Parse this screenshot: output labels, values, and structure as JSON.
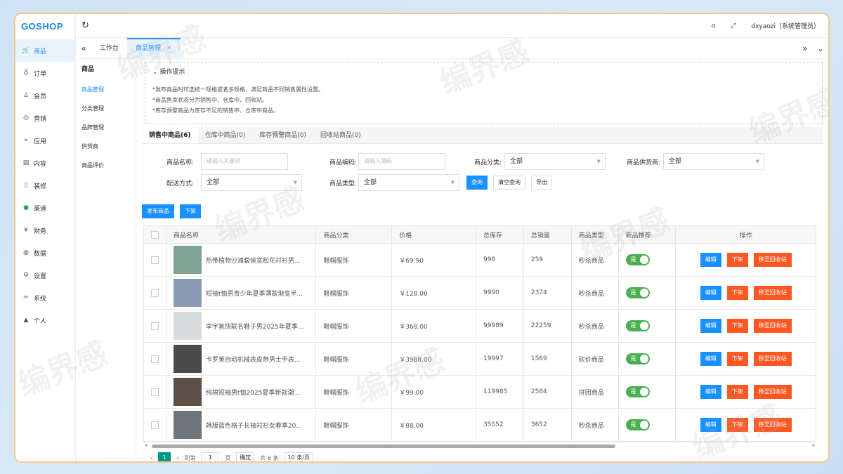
{
  "app": {
    "logo": "GOSHOP",
    "user": "dxyaozi（系统管理员）"
  },
  "sidebar": {
    "items": [
      {
        "label": "商品",
        "icon": "cart-icon",
        "glyph": "🛒",
        "active": true
      },
      {
        "label": "订单",
        "icon": "bell-icon",
        "glyph": "♁"
      },
      {
        "label": "会员",
        "icon": "user-icon",
        "glyph": "♙"
      },
      {
        "label": "营销",
        "icon": "gift-icon",
        "glyph": "◎"
      },
      {
        "label": "应用",
        "icon": "send-icon",
        "glyph": "➢"
      },
      {
        "label": "内容",
        "icon": "book-icon",
        "glyph": "▤"
      },
      {
        "label": "装修",
        "icon": "phone-icon",
        "glyph": "▯"
      },
      {
        "label": "渠道",
        "icon": "wechat-icon",
        "glyph": "●"
      },
      {
        "label": "财务",
        "icon": "money-icon",
        "glyph": "¥"
      },
      {
        "label": "数据",
        "icon": "globe-icon",
        "glyph": "◍"
      },
      {
        "label": "设置",
        "icon": "settings-icon",
        "glyph": "⚙"
      },
      {
        "label": "系统",
        "icon": "tool-icon",
        "glyph": "✂"
      },
      {
        "label": "个人",
        "icon": "person-icon",
        "glyph": "▲"
      }
    ]
  },
  "tabs": {
    "home": "工作台",
    "current": "商品管理",
    "close": "×",
    "left": "«",
    "right": "»",
    "down": "⌄"
  },
  "submenu": {
    "title": "商品",
    "items": [
      {
        "label": "商品管理",
        "active": true
      },
      {
        "label": "分类管理"
      },
      {
        "label": "品牌管理"
      },
      {
        "label": "供货商"
      },
      {
        "label": "商品评价"
      }
    ]
  },
  "tips": {
    "title": "操作提示",
    "lines": [
      "*发布商品时可选统一规格或者多规格，满足商品不同销售属性设置。",
      "*商品售卖状态分为销售中、仓库中、回收站。",
      "*库存预警商品为库存不足的销售中、仓库中商品。"
    ]
  },
  "content_tabs": [
    {
      "label": "销售中商品(6)",
      "active": true
    },
    {
      "label": "仓库中商品(0)"
    },
    {
      "label": "库存预警商品(0)"
    },
    {
      "label": "回收站商品(0)"
    }
  ],
  "filters": {
    "name_label": "商品名称:",
    "name_placeholder": "请输入关键词",
    "code_label": "商品编码:",
    "code_placeholder": "请输入编码",
    "category_label": "商品分类:",
    "category_value": "全部",
    "supplier_label": "商品供货商:",
    "supplier_value": "全部",
    "delivery_label": "配送方式:",
    "delivery_value": "全部",
    "type_label": "商品类型:",
    "type_value": "全部",
    "search": "查询",
    "clear": "清空查询",
    "export": "导出"
  },
  "actions": {
    "publish": "发布商品",
    "offshelf": "下架"
  },
  "table": {
    "headers": [
      "商品名称",
      "商品分类",
      "价格",
      "总库存",
      "总销量",
      "商品类型",
      "新品推荐",
      "操作"
    ],
    "edit": "编辑",
    "down": "下架",
    "recycle": "移至回收站",
    "toggle": "是",
    "rows": [
      {
        "name": "热带植物沙滩套装宽松花衬衫男...",
        "category": "鞋帽服饰",
        "price": "￥69.90",
        "stock": "998",
        "sales": "259",
        "type": "秒杀商品",
        "thumb": "#7fa393"
      },
      {
        "name": "短袖t恤男青少年夏季薄款渐变半...",
        "category": "鞋帽服饰",
        "price": "￥128.00",
        "stock": "9990",
        "sales": "2374",
        "type": "秒杀商品",
        "thumb": "#8a9bb5"
      },
      {
        "name": "李宇氢快联名鞋子男2025年夏季...",
        "category": "鞋帽服饰",
        "price": "￥368.00",
        "stock": "99989",
        "sales": "22259",
        "type": "秒杀商品",
        "thumb": "#d9dcdc"
      },
      {
        "name": "卡罗莱自动机械表皮带男士手表...",
        "category": "鞋帽服饰",
        "price": "￥3988.00",
        "stock": "19997",
        "sales": "1569",
        "type": "砍价商品",
        "thumb": "#4a4a4a"
      },
      {
        "name": "纯棉短袖男t恤2025夏季新款潮流...",
        "category": "鞋帽服饰",
        "price": "￥99.00",
        "stock": "119985",
        "sales": "2584",
        "type": "拼团商品",
        "thumb": "#5c4f47"
      },
      {
        "name": "韩版蓝色格子长袖衬衫女春季202...",
        "category": "鞋帽服饰",
        "price": "￥88.00",
        "stock": "35552",
        "sales": "3652",
        "type": "秒杀商品",
        "thumb": "#6e7479"
      }
    ]
  },
  "pager": {
    "page": "1",
    "goto": "到第",
    "page_input": "1",
    "page_unit": "页",
    "confirm": "确定",
    "total": "共 6 条",
    "per_page": "10 条/页"
  },
  "watermark": "编界感",
  "colors": {
    "accent": "#1890ff",
    "danger": "#ff5722",
    "toggle": "#4caf50",
    "pager": "#009688"
  }
}
